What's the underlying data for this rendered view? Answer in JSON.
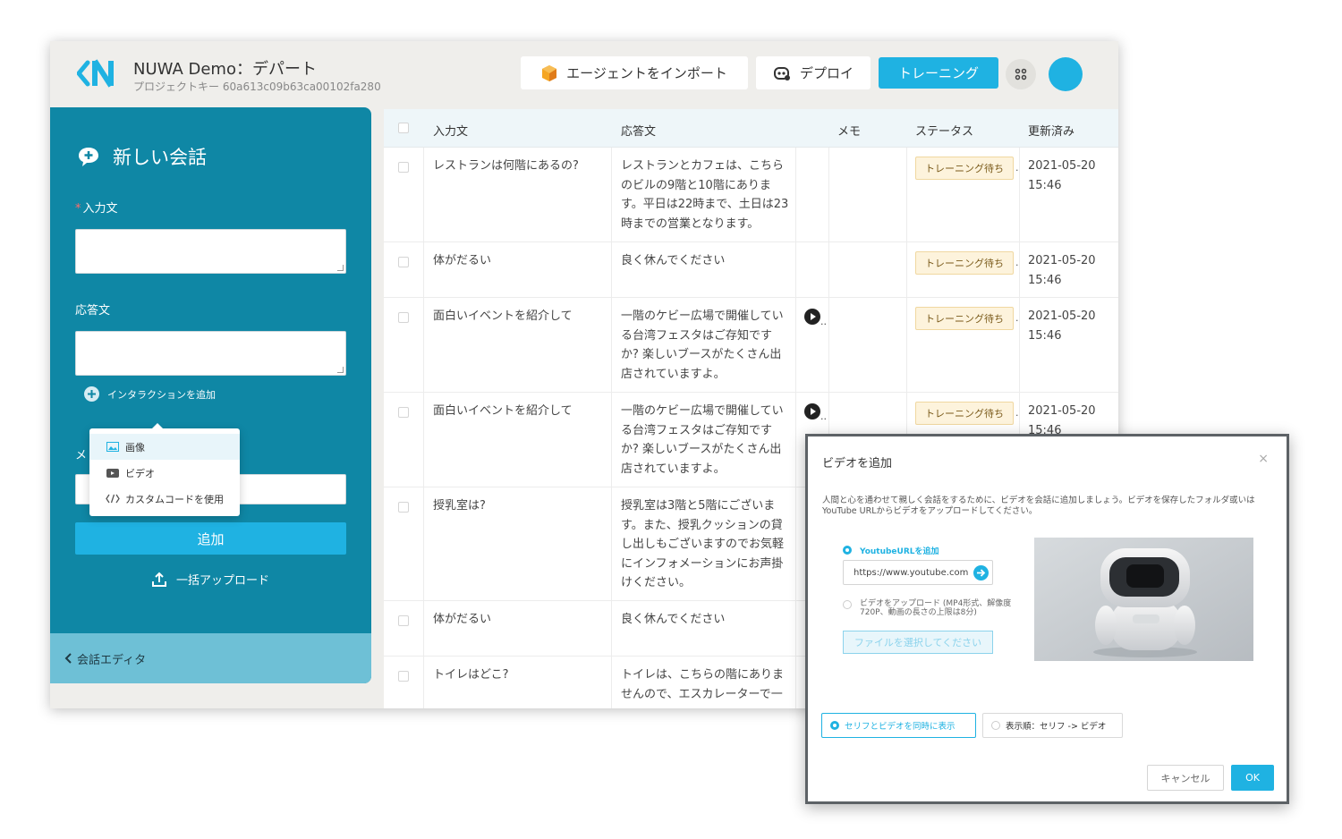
{
  "header": {
    "title": "NUWA Demo：デパート",
    "project_key": "プロジェクトキー 60a613c09b63ca00102fa280",
    "import_label": "エージェントをインポート",
    "deploy_label": "デプロイ",
    "train_label": "トレーニング",
    "icons": {
      "logo": "nuwa-logo",
      "import": "cube-icon",
      "deploy": "robot-icon",
      "apps": "apps-grid-icon"
    }
  },
  "colors": {
    "accent": "#1fb2e2",
    "panel": "#0f87a5",
    "panel_footer": "#6ec0d6",
    "badge_bg": "#fdf3dc"
  },
  "panel": {
    "title": "新しい会話",
    "input_label": "入力文",
    "input_required_mark": "*",
    "response_label": "応答文",
    "add_interaction": "インタラクションを追加",
    "memo_label": "メ",
    "add_button": "追加",
    "bulk_upload": "一括アップロード",
    "footer": "会話エディタ"
  },
  "dropdown": {
    "items": [
      {
        "label": "画像",
        "icon": "image-icon"
      },
      {
        "label": "ビデオ",
        "icon": "video-icon"
      },
      {
        "label": "カスタムコードを使用",
        "icon": "code-icon"
      }
    ]
  },
  "table": {
    "columns": [
      "入力文",
      "応答文",
      "メモ",
      "ステータス",
      "更新済み"
    ],
    "rows": [
      {
        "input": "レストランは何階にあるの?",
        "response": "レストランとカフェは、こちらのビルの9階と10階にあります。平日は22時まで、土日は23時までの営業となります。",
        "memo": "",
        "status": "トレーニング待ち",
        "updated": "2021-05-20 15:46"
      },
      {
        "input": "体がだるい",
        "response": "良く休んでください",
        "memo": "",
        "status": "トレーニング待ち",
        "updated": "2021-05-20 15:46"
      },
      {
        "input": "面白いイベントを紹介して",
        "response": "一階のケビー広場で開催している台湾フェスタはご存知ですか? 楽しいブースがたくさん出店されていますよ。",
        "memo": "..",
        "status": "トレーニング待ち",
        "updated": "2021-05-20 15:46"
      },
      {
        "input": "面白いイベントを紹介して",
        "response": "一階のケビー広場で開催している台湾フェスタはご存知ですか? 楽しいブースがたくさん出店されていますよ。",
        "memo": "..",
        "status": "トレーニング待ち",
        "updated": "2021-05-20 15:46"
      },
      {
        "input": "授乳室は?",
        "response": "授乳室は3階と5階にございます。また、授乳クッションの貸し出しもございますのでお気軽にインフォメーションにお声掛けください。"
      },
      {
        "input": "体がだるい",
        "response": "良く休んでください"
      },
      {
        "input": "トイレはどこ?",
        "response": "トイレは、こちらの階にありませんので、エスカレーターで一"
      }
    ],
    "badge_overflow": "."
  },
  "modal": {
    "title": "ビデオを追加",
    "close": "×",
    "description": "人間と心を通わせて親しく会話をするために、ビデオを会話に追加しましょう。ビデオを保存したフォルダ或いはYouTube URLからビデオをアップロードしてください。",
    "option_youtube": "YoutubeURLを追加",
    "url_value": "https://www.youtube.com",
    "option_upload": "ビデオをアップロード (MP4形式、解像度720P、動画の長さの上限は8分)",
    "file_button": "ファイルを選択してください",
    "display_simultaneous": "セリフとビデオを同時に表示",
    "display_sequential": "表示順：セリフ -> ビデオ",
    "cancel": "キャンセル",
    "ok": "OK"
  }
}
